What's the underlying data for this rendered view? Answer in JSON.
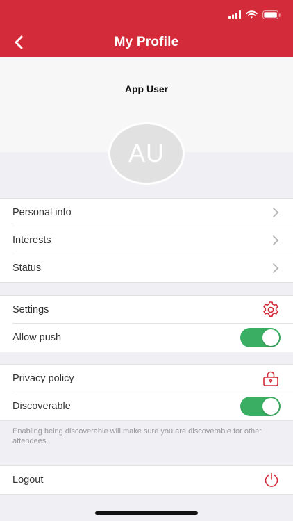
{
  "header": {
    "title": "My Profile"
  },
  "profile": {
    "name": "App User",
    "initials": "AU"
  },
  "sections": {
    "info": [
      {
        "label": "Personal info"
      },
      {
        "label": "Interests"
      },
      {
        "label": "Status"
      }
    ],
    "settings": {
      "settings_label": "Settings",
      "push_label": "Allow push",
      "push_enabled": true
    },
    "privacy": {
      "policy_label": "Privacy policy",
      "discoverable_label": "Discoverable",
      "discoverable_enabled": true,
      "note": "Enabling being discoverable will make sure you are discoverable for other attendees."
    },
    "logout": {
      "label": "Logout"
    }
  },
  "colors": {
    "brand_red": "#d32b3a",
    "toggle_green": "#3aae62",
    "background": "#efeff4"
  },
  "icons": {
    "back": "chevron-left-icon",
    "row_arrow": "chevron-right-icon",
    "settings": "gear-icon",
    "privacy": "lock-icon",
    "logout": "power-icon"
  }
}
